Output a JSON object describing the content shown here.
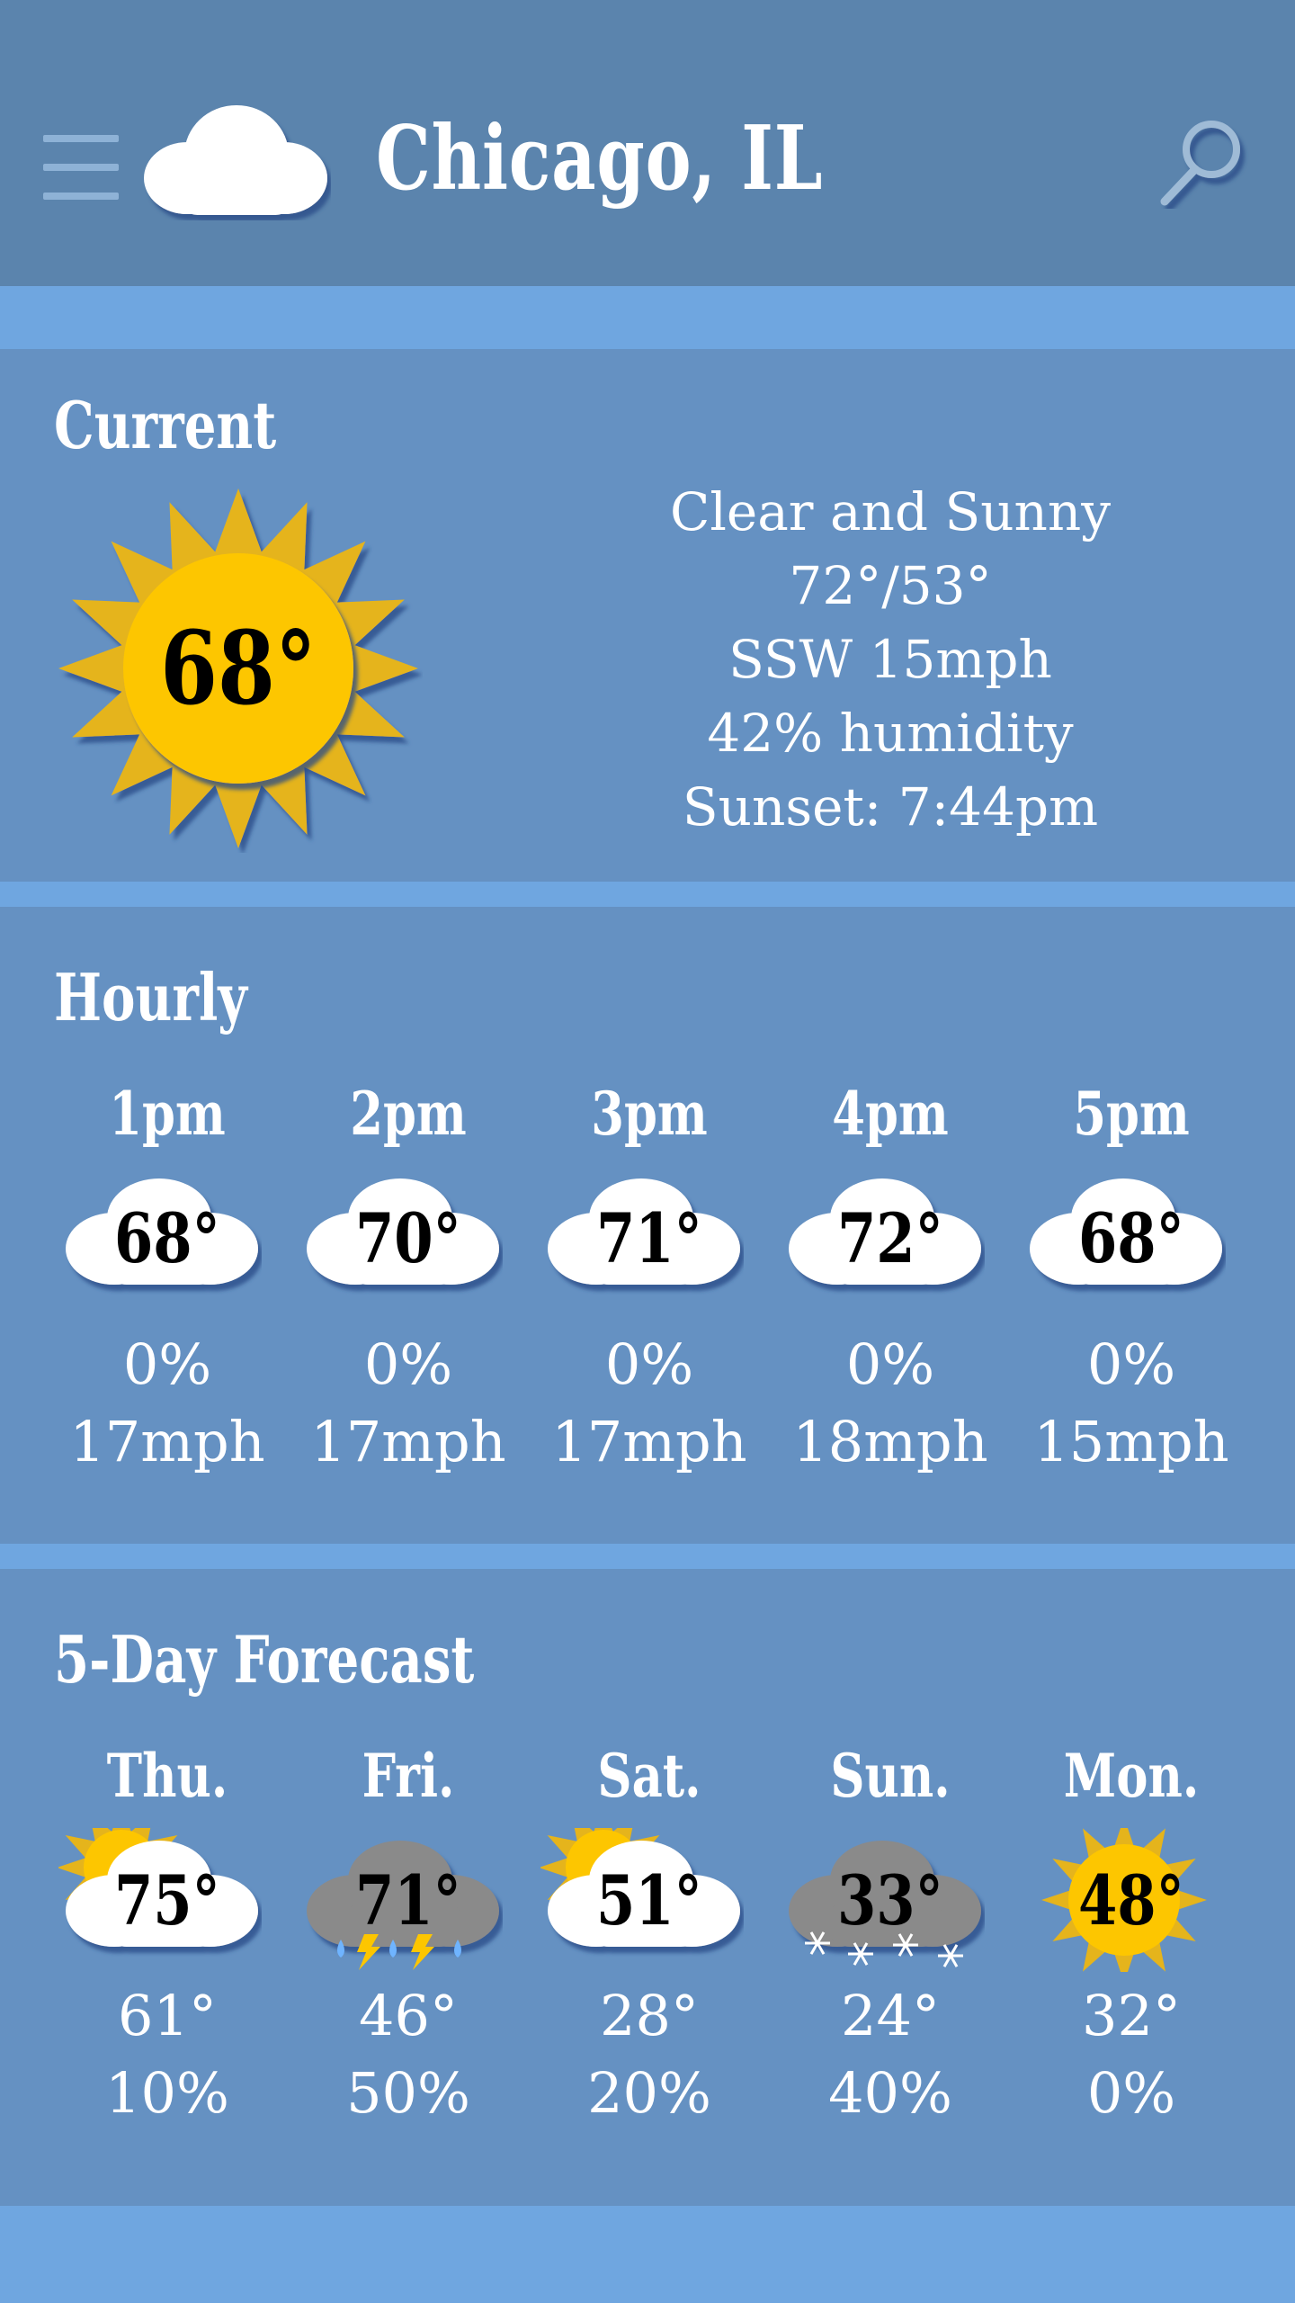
{
  "header": {
    "city": "Chicago, IL",
    "menu_icon": "hamburger-icon",
    "logo_icon": "cloud-icon",
    "search_icon": "search-icon"
  },
  "colors": {
    "header_bg": "#5b84ad",
    "panel_bg": "#6591c2",
    "divider": "#6fa6e0",
    "sun": "#fdc600",
    "sun_ray": "#e5b41c",
    "cloud": "#ffffff",
    "storm_cloud": "#8a8a8a"
  },
  "current": {
    "title": "Current",
    "icon": "sun-icon",
    "temp": "68°",
    "condition": "Clear and Sunny",
    "hilo": "72°/53°",
    "wind": "SSW 15mph",
    "humidity": "42% humidity",
    "sunset": "Sunset: 7:44pm"
  },
  "hourly": {
    "title": "Hourly",
    "items": [
      {
        "time": "1pm",
        "icon": "cloud-icon",
        "temp": "68°",
        "precip": "0%",
        "wind": "17mph"
      },
      {
        "time": "2pm",
        "icon": "cloud-icon",
        "temp": "70°",
        "precip": "0%",
        "wind": "17mph"
      },
      {
        "time": "3pm",
        "icon": "cloud-icon",
        "temp": "71°",
        "precip": "0%",
        "wind": "17mph"
      },
      {
        "time": "4pm",
        "icon": "cloud-icon",
        "temp": "72°",
        "precip": "0%",
        "wind": "18mph"
      },
      {
        "time": "5pm",
        "icon": "cloud-icon",
        "temp": "68°",
        "precip": "0%",
        "wind": "15mph"
      }
    ]
  },
  "forecast": {
    "title": "5-Day Forecast",
    "days": [
      {
        "day": "Thu.",
        "icon": "partly-cloudy-icon",
        "high": "75°",
        "low": "61°",
        "precip": "10%"
      },
      {
        "day": "Fri.",
        "icon": "thunderstorm-icon",
        "high": "71°",
        "low": "46°",
        "precip": "50%"
      },
      {
        "day": "Sat.",
        "icon": "partly-cloudy-icon",
        "high": "51°",
        "low": "28°",
        "precip": "20%"
      },
      {
        "day": "Sun.",
        "icon": "snow-icon",
        "high": "33°",
        "low": "24°",
        "precip": "40%"
      },
      {
        "day": "Mon.",
        "icon": "sun-icon",
        "high": "48°",
        "low": "32°",
        "precip": "0%"
      }
    ]
  }
}
